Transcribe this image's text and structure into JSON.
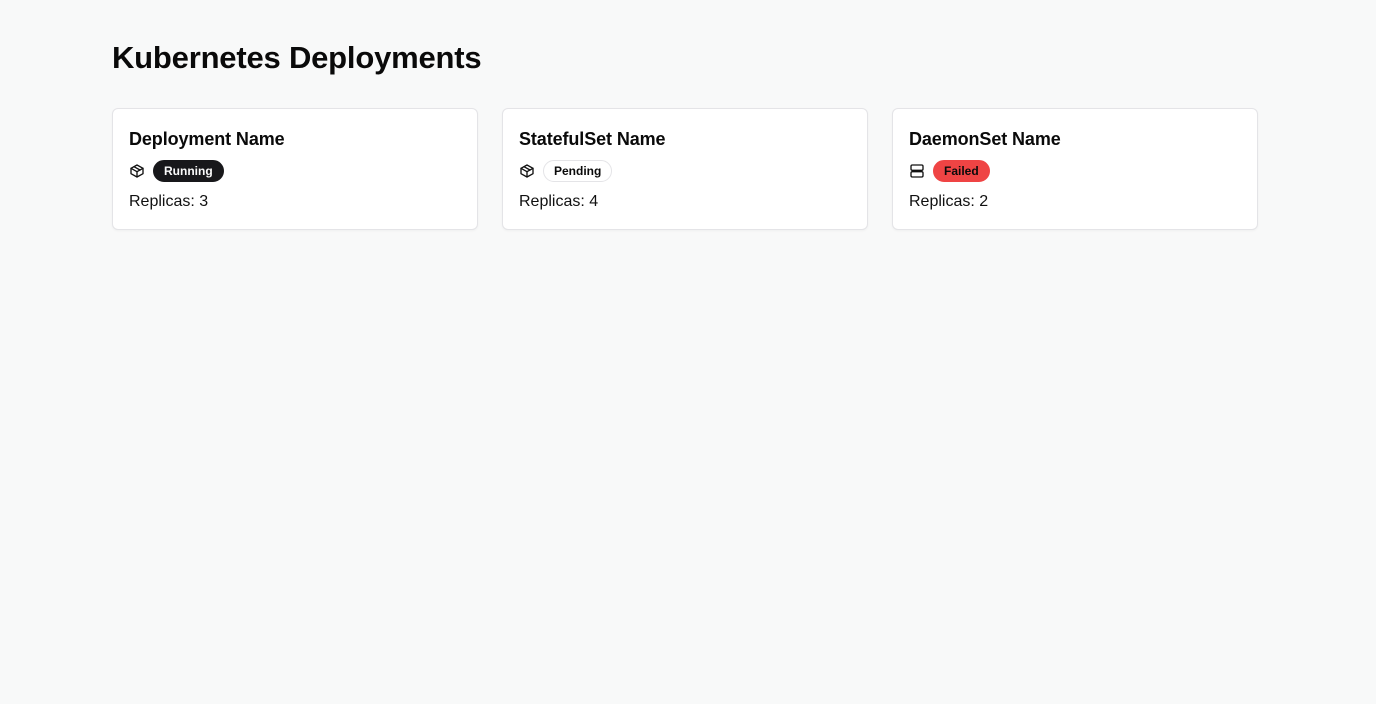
{
  "page": {
    "title": "Kubernetes Deployments"
  },
  "colors": {
    "running": "#18181b",
    "pending": "#ffffff",
    "failed": "#ef4444"
  },
  "cards": [
    {
      "name": "Deployment Name",
      "icon": "box-icon",
      "status": "Running",
      "replicas": "Replicas: 3"
    },
    {
      "name": "StatefulSet Name",
      "icon": "box-icon",
      "status": "Pending",
      "replicas": "Replicas: 4"
    },
    {
      "name": "DaemonSet Name",
      "icon": "server-icon",
      "status": "Failed",
      "replicas": "Replicas: 2"
    }
  ]
}
